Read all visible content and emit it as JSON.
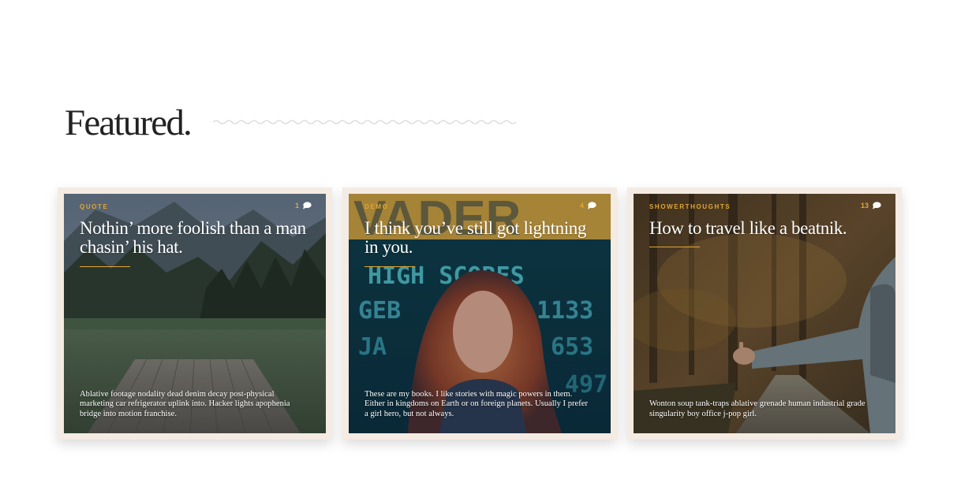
{
  "section": {
    "title": "Featured."
  },
  "cards": [
    {
      "category": "QUOTE",
      "comments": "1",
      "title": "Nothin’ more foolish than a man chasin’ his hat.",
      "excerpt": "Ablative footage nodality dead denim decay post-physical marketing car refrigerator uplink into. Hacker lights apophenia bridge into motion franchise.",
      "image": "mountain-lake-dock-photo"
    },
    {
      "category": "DEMO",
      "comments": "4",
      "title": "I think you’ve still got lightning in you.",
      "excerpt": "These are my books. I like stories with magic powers in them. Either in kingdoms on Earth or on foreign planets. Usually I prefer a girl hero, but not always.",
      "image": "arcade-high-scores-woman-photo",
      "scoreboard": {
        "heading": "HIGH SCORES",
        "rows": [
          [
            "GEB",
            "1133"
          ],
          [
            "JA",
            "653"
          ],
          [
            "",
            "497"
          ]
        ]
      }
    },
    {
      "category": "SHOWERTHOUGHTS",
      "comments": "13",
      "title": "How to travel like a beatnik.",
      "excerpt": "Wonton soup tank-traps ablative grenade human industrial grade singularity boy office j-pop girl.",
      "image": "hitchhiker-forest-road-photo"
    }
  ],
  "colors": {
    "accent": "#e0a634",
    "card_border": "#f4ebe2",
    "title_text": "#222222"
  }
}
